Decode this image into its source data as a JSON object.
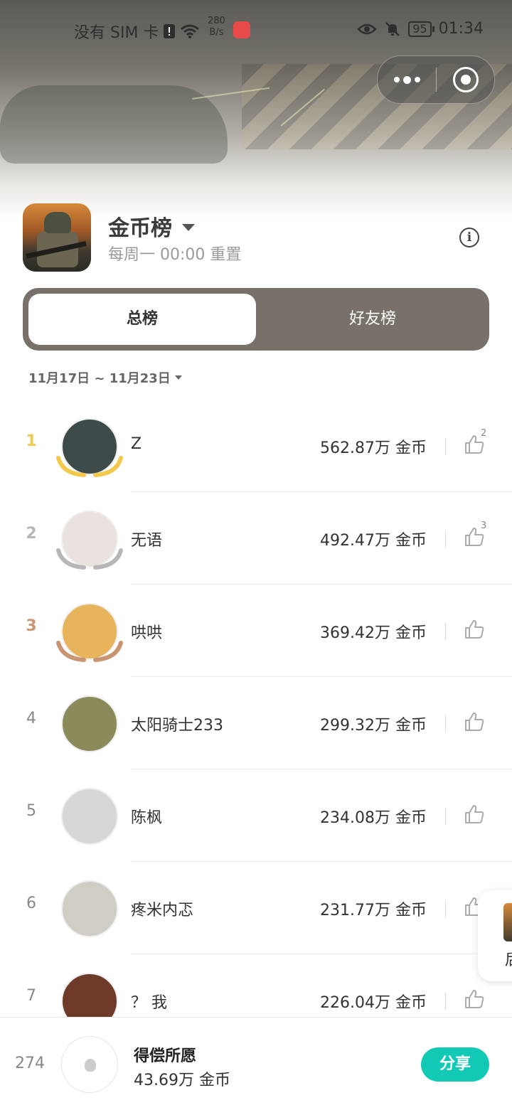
{
  "status_bar": {
    "carrier": "没有 SIM 卡",
    "net_speed_value": "280",
    "net_speed_unit": "B/s",
    "battery": "95",
    "time": "01:34",
    "icons": [
      "sim-alert-icon",
      "wifi-icon",
      "huawei-app-icon",
      "eye-icon",
      "mute-bell-icon",
      "battery-icon"
    ]
  },
  "header": {
    "title": "金币榜",
    "subtitle": "每周一 00:00 重置",
    "info_glyph": "i"
  },
  "tabs": [
    {
      "label": "总榜",
      "active": true
    },
    {
      "label": "好友榜",
      "active": false
    }
  ],
  "date_range": "11月17日 ~ 11月23日",
  "rows": [
    {
      "rank": "1",
      "name": "Z",
      "score": "562.87万 金币",
      "likes": "2",
      "avatar_color": "#3c4a4a"
    },
    {
      "rank": "2",
      "name": "无语",
      "score": "492.47万 金币",
      "likes": "3",
      "avatar_color": "#e9e2de"
    },
    {
      "rank": "3",
      "name": "哄哄",
      "score": "369.42万 金币",
      "likes": "",
      "avatar_color": "#e7b45c"
    },
    {
      "rank": "4",
      "name": "太阳骑士233",
      "score": "299.32万 金币",
      "likes": "",
      "avatar_color": "#8b8a5a"
    },
    {
      "rank": "5",
      "name": "陈枫",
      "score": "234.08万 金币",
      "likes": "",
      "avatar_color": "#d9d6d8"
    },
    {
      "rank": "6",
      "name": "疼米内忑",
      "score": "231.77万 金币",
      "likes": "",
      "avatar_color": "#cfcdc4"
    },
    {
      "rank": "7",
      "name": "？ 我",
      "score": "226.04万 金币",
      "likes": "",
      "avatar_color": "#6e3b2a"
    }
  ],
  "float_card": {
    "text": "后"
  },
  "me": {
    "rank": "274",
    "name": "得偿所愿",
    "score": "43.69万 金币",
    "share_label": "分享"
  },
  "colors": {
    "accent_share": "#12c9b5",
    "tab_bar": "#78716a",
    "gold": "#f2c94c",
    "silver": "#b7b7b7",
    "bronze": "#c99472"
  }
}
